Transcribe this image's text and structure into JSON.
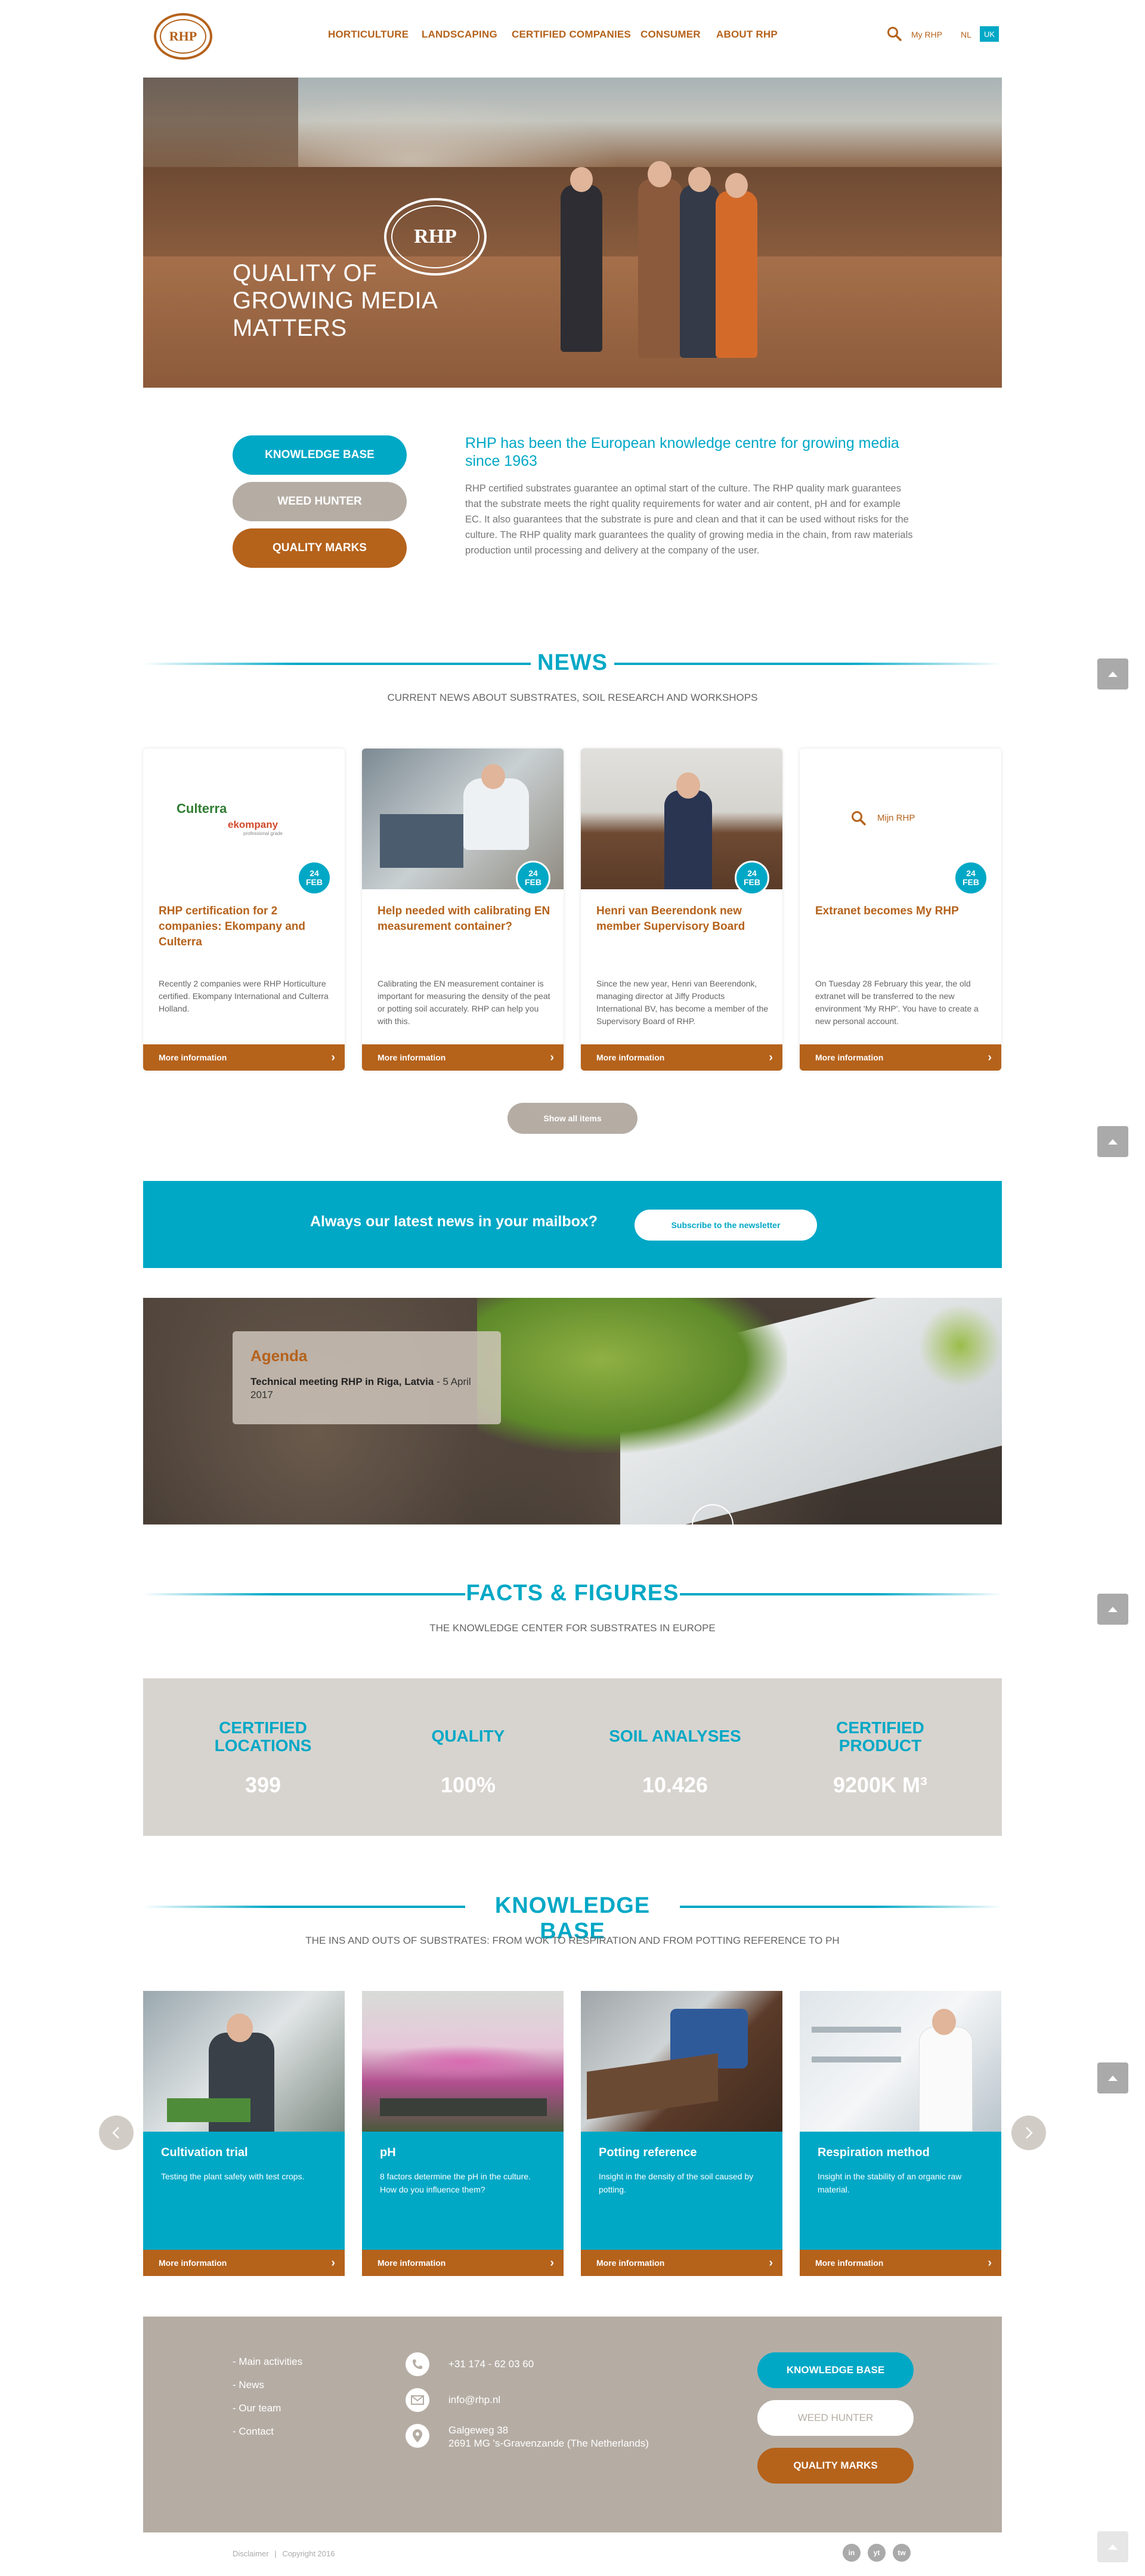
{
  "header": {
    "logo_text": "RHP",
    "nav": [
      "Horticulture",
      "Landscaping",
      "Certified companies",
      "Consumer",
      "About RHP"
    ],
    "my_rhp": "My RHP",
    "lang_nl": "NL",
    "lang_uk": "UK"
  },
  "hero": {
    "title_line1": "Quality of",
    "title_line2": "growing media",
    "title_line3": "matters",
    "emblem": "RHP"
  },
  "intro": {
    "buttons": [
      "Knowledge base",
      "Weed hunter",
      "Quality marks"
    ],
    "heading": "RHP has been the European knowledge centre for growing media since 1963",
    "body": "RHP certified substrates guarantee an optimal start of the culture. The RHP quality mark guarantees that the substrate meets the right quality requirements for water and air content, pH and for example EC. It also guarantees that the substrate is pure and clean and that it can be used without risks for the culture. The RHP quality mark guarantees the quality of growing media in the chain, from raw materials production until processing and delivery at the company of the user."
  },
  "news": {
    "heading": "News",
    "subheading": "Current news about substrates, soil research and workshops",
    "items": [
      {
        "day": "24",
        "month": "FEB",
        "title": "RHP certification for 2 companies: Ekompany and Culterra",
        "text": "Recently 2 companies were RHP Horticulture certified. Ekompany International and Culterra Holland.",
        "more": "More information",
        "logo1": "Culterra",
        "logo2": "ekompany",
        "logo2_sub": "professional grade"
      },
      {
        "day": "24",
        "month": "FEB",
        "title": "Help needed with calibrating EN measurement container?",
        "text": "Calibrating the EN measurement container is important for measuring the density of the peat or potting soil accurately. RHP can help you with this.",
        "more": "More information"
      },
      {
        "day": "24",
        "month": "FEB",
        "title": "Henri van Beerendonk new member Supervisory Board",
        "text": "Since the new year, Henri van Beerendonk, managing director at Jiffy Products International BV, has become a member of the Supervisory Board of RHP.",
        "more": "More information"
      },
      {
        "day": "24",
        "month": "FEB",
        "title": "Extranet becomes My RHP",
        "text": "On Tuesday 28 February this year, the old extranet will be transferred to the new environment 'My RHP'. You have to create a new personal account.",
        "more": "More information",
        "image_label": "Mijn RHP"
      }
    ],
    "show_all": "Show all items"
  },
  "newsletter": {
    "text": "Always our latest news in your mailbox?",
    "button": "Subscribe to the newsletter"
  },
  "agenda": {
    "title": "Agenda",
    "event": "Technical meeting RHP in Riga, Latvia",
    "date": " - 5 April 2017"
  },
  "facts": {
    "heading": "Facts & Figures",
    "subheading": "The knowledge center for substrates in Europe",
    "items": [
      {
        "label": "Certified locations",
        "value": "399"
      },
      {
        "label": "Quality",
        "value": "100%"
      },
      {
        "label": "Soil analyses",
        "value": "10.426"
      },
      {
        "label": "Certified product",
        "value": "9200K M³"
      }
    ]
  },
  "knowledge": {
    "heading": "Knowledge base",
    "subheading": "The ins and outs of substrates: from WOK to respiration and from potting reference to pH",
    "items": [
      {
        "title": "Cultivation trial",
        "text": "Testing the plant safety with test crops.",
        "more": "More information"
      },
      {
        "title": "pH",
        "text": "8 factors determine the pH in the culture. How do you influence them?",
        "more": "More information"
      },
      {
        "title": "Potting reference",
        "text": "Insight in the density of the soil caused by potting.",
        "more": "More information"
      },
      {
        "title": "Respiration method",
        "text": "Insight in the stability of an organic raw material.",
        "more": "More information"
      }
    ]
  },
  "footer": {
    "links": [
      "- Main activities",
      "- News",
      "- Our team",
      "- Contact"
    ],
    "phone": "+31 174 - 62 03 60",
    "email": "info@rhp.nl",
    "address1": "Galgeweg 38",
    "address2": "2691 MG 's-Gravenzande (The Netherlands)",
    "buttons": [
      "Knowledge base",
      "Weed hunter",
      "Quality marks"
    ],
    "disclaimer": "Disclaimer",
    "copyright": "Copyright 2016",
    "social": [
      "in",
      "yt",
      "tw"
    ]
  },
  "colors": {
    "brand": "#b5621b",
    "accent": "#00a8c6",
    "neutral": "#b5ada4"
  }
}
